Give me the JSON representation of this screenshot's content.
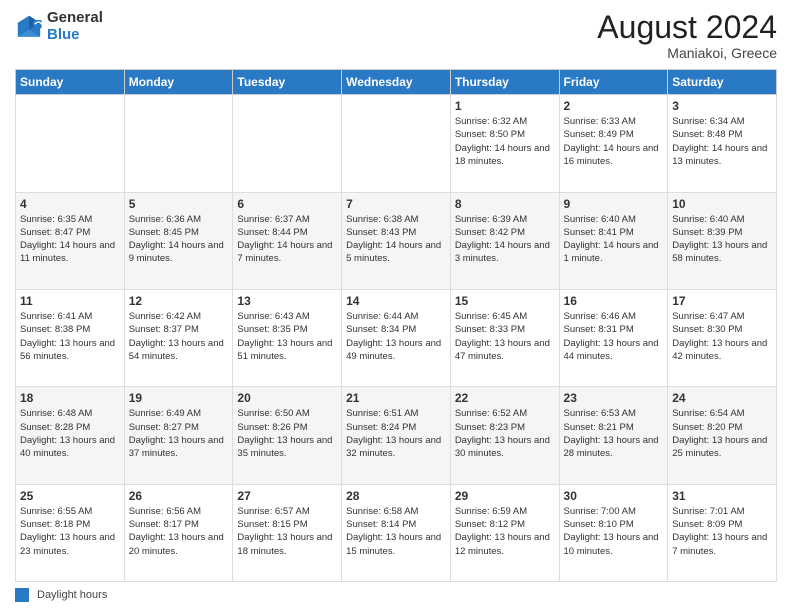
{
  "header": {
    "logo_general": "General",
    "logo_blue": "Blue",
    "month_year": "August 2024",
    "location": "Maniakoi, Greece"
  },
  "weekdays": [
    "Sunday",
    "Monday",
    "Tuesday",
    "Wednesday",
    "Thursday",
    "Friday",
    "Saturday"
  ],
  "legend": {
    "label": "Daylight hours"
  },
  "weeks": [
    [
      {
        "day": "",
        "info": ""
      },
      {
        "day": "",
        "info": ""
      },
      {
        "day": "",
        "info": ""
      },
      {
        "day": "",
        "info": ""
      },
      {
        "day": "1",
        "info": "Sunrise: 6:32 AM\nSunset: 8:50 PM\nDaylight: 14 hours and 18 minutes."
      },
      {
        "day": "2",
        "info": "Sunrise: 6:33 AM\nSunset: 8:49 PM\nDaylight: 14 hours and 16 minutes."
      },
      {
        "day": "3",
        "info": "Sunrise: 6:34 AM\nSunset: 8:48 PM\nDaylight: 14 hours and 13 minutes."
      }
    ],
    [
      {
        "day": "4",
        "info": "Sunrise: 6:35 AM\nSunset: 8:47 PM\nDaylight: 14 hours and 11 minutes."
      },
      {
        "day": "5",
        "info": "Sunrise: 6:36 AM\nSunset: 8:45 PM\nDaylight: 14 hours and 9 minutes."
      },
      {
        "day": "6",
        "info": "Sunrise: 6:37 AM\nSunset: 8:44 PM\nDaylight: 14 hours and 7 minutes."
      },
      {
        "day": "7",
        "info": "Sunrise: 6:38 AM\nSunset: 8:43 PM\nDaylight: 14 hours and 5 minutes."
      },
      {
        "day": "8",
        "info": "Sunrise: 6:39 AM\nSunset: 8:42 PM\nDaylight: 14 hours and 3 minutes."
      },
      {
        "day": "9",
        "info": "Sunrise: 6:40 AM\nSunset: 8:41 PM\nDaylight: 14 hours and 1 minute."
      },
      {
        "day": "10",
        "info": "Sunrise: 6:40 AM\nSunset: 8:39 PM\nDaylight: 13 hours and 58 minutes."
      }
    ],
    [
      {
        "day": "11",
        "info": "Sunrise: 6:41 AM\nSunset: 8:38 PM\nDaylight: 13 hours and 56 minutes."
      },
      {
        "day": "12",
        "info": "Sunrise: 6:42 AM\nSunset: 8:37 PM\nDaylight: 13 hours and 54 minutes."
      },
      {
        "day": "13",
        "info": "Sunrise: 6:43 AM\nSunset: 8:35 PM\nDaylight: 13 hours and 51 minutes."
      },
      {
        "day": "14",
        "info": "Sunrise: 6:44 AM\nSunset: 8:34 PM\nDaylight: 13 hours and 49 minutes."
      },
      {
        "day": "15",
        "info": "Sunrise: 6:45 AM\nSunset: 8:33 PM\nDaylight: 13 hours and 47 minutes."
      },
      {
        "day": "16",
        "info": "Sunrise: 6:46 AM\nSunset: 8:31 PM\nDaylight: 13 hours and 44 minutes."
      },
      {
        "day": "17",
        "info": "Sunrise: 6:47 AM\nSunset: 8:30 PM\nDaylight: 13 hours and 42 minutes."
      }
    ],
    [
      {
        "day": "18",
        "info": "Sunrise: 6:48 AM\nSunset: 8:28 PM\nDaylight: 13 hours and 40 minutes."
      },
      {
        "day": "19",
        "info": "Sunrise: 6:49 AM\nSunset: 8:27 PM\nDaylight: 13 hours and 37 minutes."
      },
      {
        "day": "20",
        "info": "Sunrise: 6:50 AM\nSunset: 8:26 PM\nDaylight: 13 hours and 35 minutes."
      },
      {
        "day": "21",
        "info": "Sunrise: 6:51 AM\nSunset: 8:24 PM\nDaylight: 13 hours and 32 minutes."
      },
      {
        "day": "22",
        "info": "Sunrise: 6:52 AM\nSunset: 8:23 PM\nDaylight: 13 hours and 30 minutes."
      },
      {
        "day": "23",
        "info": "Sunrise: 6:53 AM\nSunset: 8:21 PM\nDaylight: 13 hours and 28 minutes."
      },
      {
        "day": "24",
        "info": "Sunrise: 6:54 AM\nSunset: 8:20 PM\nDaylight: 13 hours and 25 minutes."
      }
    ],
    [
      {
        "day": "25",
        "info": "Sunrise: 6:55 AM\nSunset: 8:18 PM\nDaylight: 13 hours and 23 minutes."
      },
      {
        "day": "26",
        "info": "Sunrise: 6:56 AM\nSunset: 8:17 PM\nDaylight: 13 hours and 20 minutes."
      },
      {
        "day": "27",
        "info": "Sunrise: 6:57 AM\nSunset: 8:15 PM\nDaylight: 13 hours and 18 minutes."
      },
      {
        "day": "28",
        "info": "Sunrise: 6:58 AM\nSunset: 8:14 PM\nDaylight: 13 hours and 15 minutes."
      },
      {
        "day": "29",
        "info": "Sunrise: 6:59 AM\nSunset: 8:12 PM\nDaylight: 13 hours and 12 minutes."
      },
      {
        "day": "30",
        "info": "Sunrise: 7:00 AM\nSunset: 8:10 PM\nDaylight: 13 hours and 10 minutes."
      },
      {
        "day": "31",
        "info": "Sunrise: 7:01 AM\nSunset: 8:09 PM\nDaylight: 13 hours and 7 minutes."
      }
    ]
  ]
}
